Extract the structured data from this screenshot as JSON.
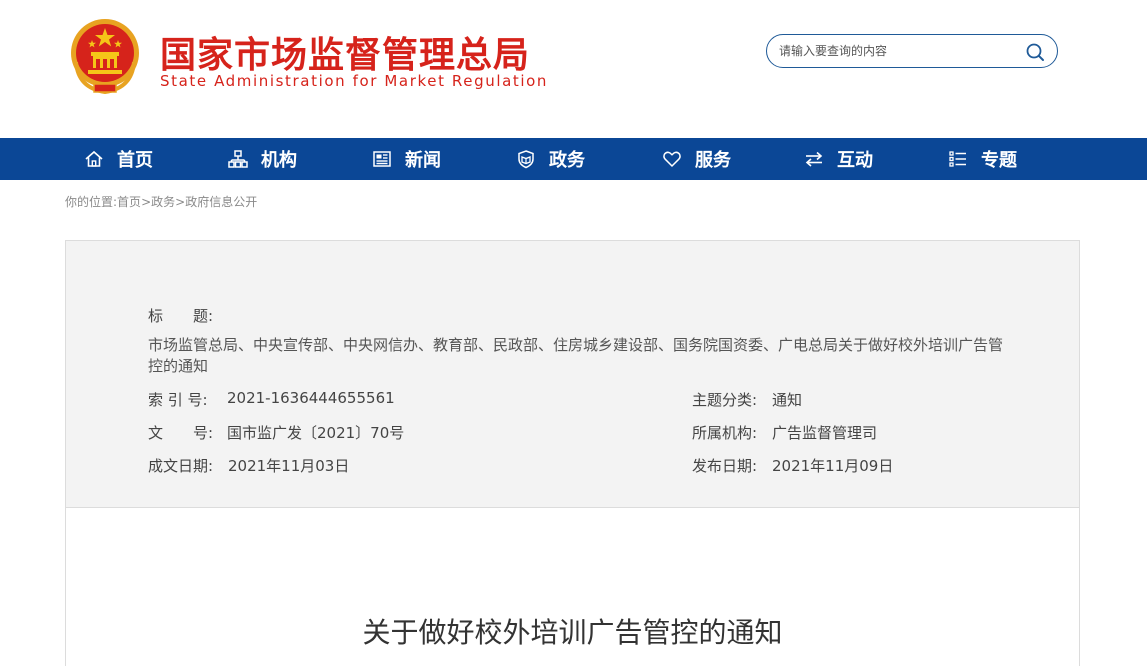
{
  "header": {
    "logo_cn": "国家市场监督管理总局",
    "logo_en": "State Administration for Market Regulation",
    "emblem_icon": "national-emblem-icon"
  },
  "search": {
    "placeholder": "请输入要查询的内容",
    "icon": "search-icon"
  },
  "nav": {
    "items": [
      {
        "label": "首页",
        "icon": "home-icon"
      },
      {
        "label": "机构",
        "icon": "org-chart-icon"
      },
      {
        "label": "新闻",
        "icon": "newspaper-icon"
      },
      {
        "label": "政务",
        "icon": "shield-book-icon"
      },
      {
        "label": "服务",
        "icon": "heart-icon"
      },
      {
        "label": "互动",
        "icon": "exchange-arrows-icon"
      },
      {
        "label": "专题",
        "icon": "list-icon"
      }
    ]
  },
  "breadcrumb": {
    "prefix": "你的位置:",
    "items": [
      "首页",
      "政务",
      "政府信息公开"
    ],
    "separator": ">"
  },
  "meta": {
    "title_label": "标　　题:",
    "title_value": "市场监管总局、中央宣传部、中央网信办、教育部、民政部、住房城乡建设部、国务院国资委、广电总局关于做好校外培训广告管控的通知",
    "index_label": "索 引 号:",
    "index_value": "2021-1636444655561",
    "doc_no_label": "文　　号:",
    "doc_no_value": "国市监广发〔2021〕70号",
    "created_label": "成文日期:",
    "created_value": "2021年11月03日",
    "category_label": "主题分类:",
    "category_value": "通知",
    "agency_label": "所属机构:",
    "agency_value": "广告监督管理司",
    "published_label": "发布日期:",
    "published_value": "2021年11月09日"
  },
  "document": {
    "title": "关于做好校外培训广告管控的通知"
  },
  "colors": {
    "brand_red": "#d6231b",
    "nav_blue": "#0b4796",
    "search_border": "#1f5a98"
  }
}
